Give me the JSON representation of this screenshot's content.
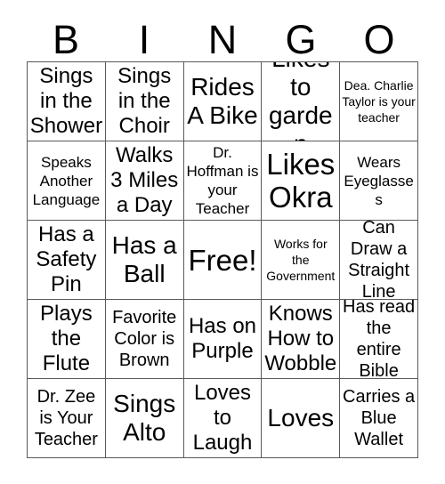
{
  "card": {
    "title_letters": [
      "B",
      "I",
      "N",
      "G",
      "O"
    ],
    "columns": 5,
    "rows": 5,
    "border_color": "#5a5a5a",
    "background_color": "#ffffff",
    "text_color": "#000000",
    "free_space": {
      "row": 3,
      "column": 3,
      "label": "Free!"
    }
  },
  "squares": [
    [
      {
        "text": "Sings in the Shower",
        "size": "lg"
      },
      {
        "text": "Sings in the Choir",
        "size": "lg"
      },
      {
        "text": "Rides A Bike",
        "size": "xl"
      },
      {
        "text": "Likes to garden",
        "size": "xl"
      },
      {
        "text": "Dea. Charlie Taylor is your teacher",
        "size": "xs"
      }
    ],
    [
      {
        "text": "Speaks Another Language",
        "size": "sm"
      },
      {
        "text": "Walks 3 Miles a Day",
        "size": "lg"
      },
      {
        "text": "Dr. Hoffman is your Teacher",
        "size": "sm"
      },
      {
        "text": "Likes Okra",
        "size": "xxl"
      },
      {
        "text": "Wears Eyeglasses",
        "size": "sm"
      }
    ],
    [
      {
        "text": "Has a Safety Pin",
        "size": "lg"
      },
      {
        "text": "Has a Ball",
        "size": "xl"
      },
      {
        "text": "Free!",
        "size": "xxl"
      },
      {
        "text": "Works for the Government",
        "size": "xs"
      },
      {
        "text": "Can Draw a Straight Line",
        "size": "md"
      }
    ],
    [
      {
        "text": "Plays the Flute",
        "size": "lg"
      },
      {
        "text": "Favorite Color is Brown",
        "size": "md"
      },
      {
        "text": "Has on Purple",
        "size": "lg"
      },
      {
        "text": "Knows How to Wobble",
        "size": "lg"
      },
      {
        "text": "Has read the entire Bible",
        "size": "md"
      }
    ],
    [
      {
        "text": "Dr. Zee is Your Teacher",
        "size": "md"
      },
      {
        "text": "Sings Alto",
        "size": "xl"
      },
      {
        "text": "Loves to Laugh",
        "size": "lg"
      },
      {
        "text": "Loves",
        "size": "xl"
      },
      {
        "text": "Carries a Blue Wallet",
        "size": "md"
      }
    ]
  ]
}
